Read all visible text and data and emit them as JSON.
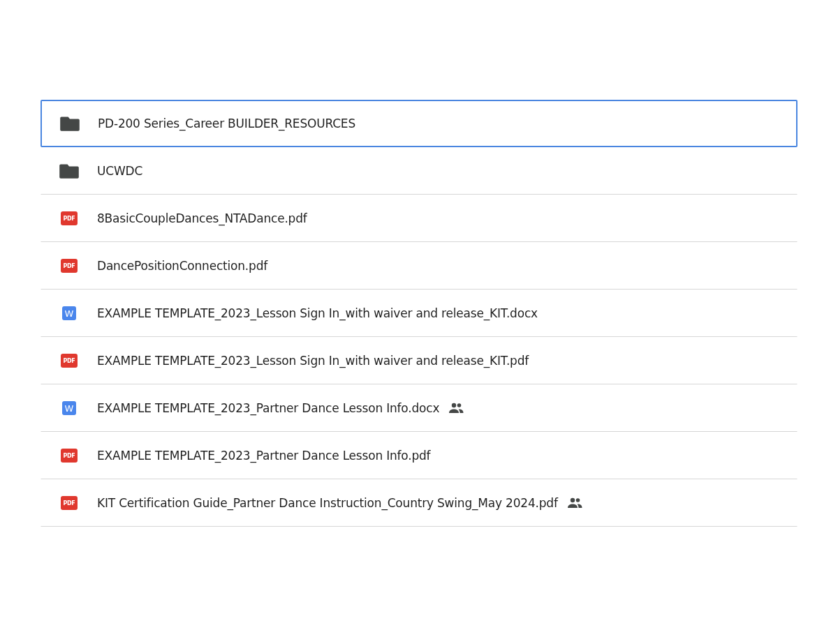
{
  "files": [
    {
      "kind": "folder",
      "name": "PD-200 Series_Career BUILDER_RESOURCES",
      "selected": true,
      "shared": false
    },
    {
      "kind": "folder",
      "name": "UCWDC",
      "selected": false,
      "shared": false
    },
    {
      "kind": "pdf",
      "icon_label": "PDF",
      "name": "8BasicCoupleDances_NTADance.pdf",
      "selected": false,
      "shared": false
    },
    {
      "kind": "pdf",
      "icon_label": "PDF",
      "name": "DancePositionConnection.pdf",
      "selected": false,
      "shared": false
    },
    {
      "kind": "doc",
      "icon_label": "W",
      "name": "EXAMPLE TEMPLATE_2023_Lesson Sign In_with waiver and release_KIT.docx",
      "selected": false,
      "shared": false
    },
    {
      "kind": "pdf",
      "icon_label": "PDF",
      "name": "EXAMPLE TEMPLATE_2023_Lesson Sign In_with waiver and release_KIT.pdf",
      "selected": false,
      "shared": false
    },
    {
      "kind": "doc",
      "icon_label": "W",
      "name": "EXAMPLE TEMPLATE_2023_Partner Dance Lesson Info.docx",
      "selected": false,
      "shared": true
    },
    {
      "kind": "pdf",
      "icon_label": "PDF",
      "name": "EXAMPLE TEMPLATE_2023_Partner Dance Lesson Info.pdf",
      "selected": false,
      "shared": false
    },
    {
      "kind": "pdf",
      "icon_label": "PDF",
      "name": "KIT Certification Guide_Partner Dance Instruction_Country Swing_May 2024.pdf",
      "selected": false,
      "shared": true
    }
  ]
}
